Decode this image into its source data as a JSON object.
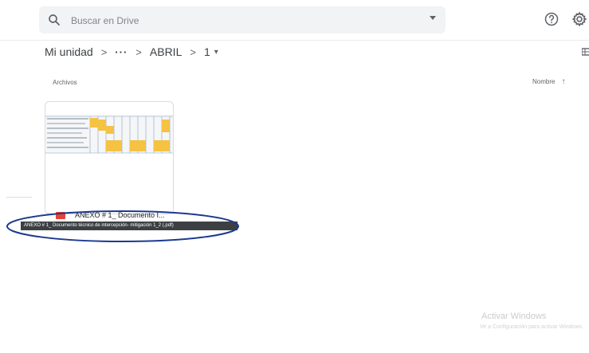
{
  "search": {
    "placeholder": "Buscar en Drive",
    "icon": "search-icon",
    "options_icon": "caret-down-icon"
  },
  "header": {
    "help_icon": "help-icon",
    "settings_icon": "gear-icon"
  },
  "breadcrumb": {
    "items": [
      "Mi unidad",
      "···",
      "ABRIL",
      "1"
    ],
    "separator": ">",
    "current_caret": "▾"
  },
  "section": {
    "label": "Archivos",
    "sort_label": "Nombre",
    "sort_direction_icon": "arrow-up-icon"
  },
  "files": [
    {
      "name": "ANEXO # 1_ Documento I...",
      "type_icon": "pdf-icon",
      "tooltip": "ANEXO # 1_ Documento técnico de intercepción- mitigación 1_2 (.pdf)"
    }
  ],
  "watermark": {
    "title": "Activar Windows",
    "subtitle": "Ve a Configuración para activar Windows."
  },
  "colors": {
    "tooltip_bg": "#3c4043",
    "highlight_ellipse": "#1a3a8f",
    "thumbnail_cell_highlight": "#f5c242",
    "pdf_badge": "#ea4335"
  }
}
